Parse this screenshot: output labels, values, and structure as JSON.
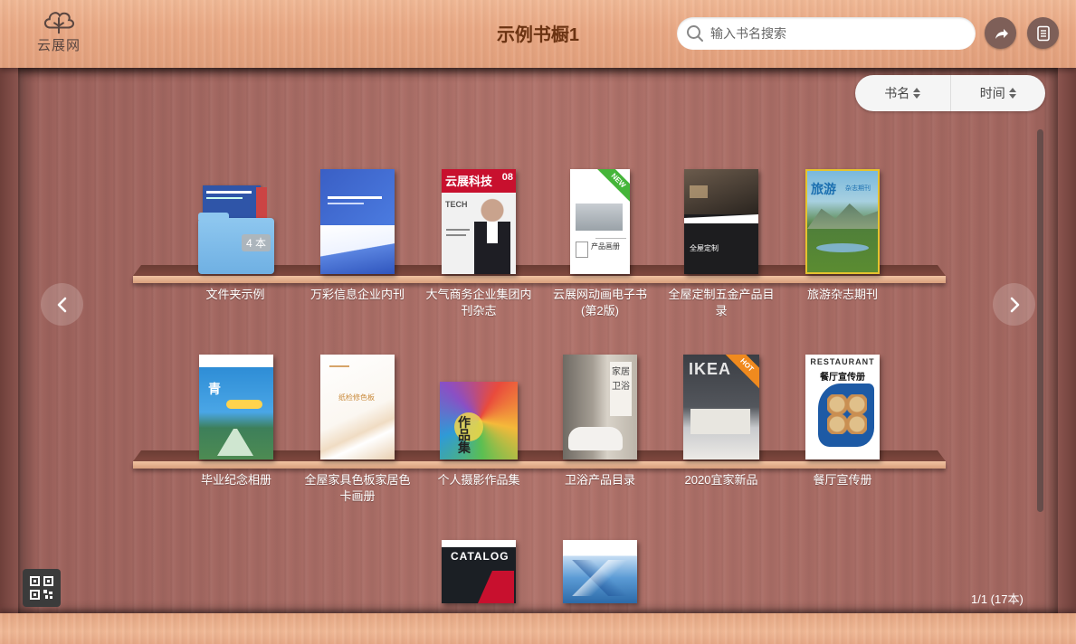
{
  "app": {
    "logo_text": "云展网",
    "title": "示例书橱1"
  },
  "search": {
    "placeholder": "输入书名搜索"
  },
  "toolbar": {
    "share_icon": "share-arrow-icon",
    "doc_icon": "document-icon"
  },
  "sort": {
    "by_name": "书名",
    "by_time": "时间"
  },
  "shelf1": [
    {
      "label": "文件夹示例",
      "folder_count": "4 本"
    },
    {
      "label": "万彩信息企业内刊"
    },
    {
      "label": "大气商务企业集团内刊杂志"
    },
    {
      "label": "云展网动画电子书(第2版)"
    },
    {
      "label": "全屋定制五金产品目录"
    },
    {
      "label": "旅游杂志期刊"
    }
  ],
  "shelf2": [
    {
      "label": "毕业纪念相册"
    },
    {
      "label": "全屋家具色板家居色卡画册"
    },
    {
      "label": "个人摄影作品集"
    },
    {
      "label": "卫浴产品目录"
    },
    {
      "label": "2020宜家新品"
    },
    {
      "label": "餐厅宣传册"
    }
  ],
  "covers": {
    "tech_title": "云展科技",
    "tech_issue": "08",
    "tech_sub": "TECH",
    "new_badge": "NEW",
    "hot_badge": "HOT",
    "travel_title": "旅游",
    "travel_tag": "杂志期刊",
    "restaurant_title": "RESTAURANT",
    "restaurant_sub": "餐厅宣传册",
    "works_title": "作品集",
    "bath_title": "家居卫浴",
    "ikea_title": "IKEA",
    "catalog_title": "CATALOG",
    "product_book": "产品画册",
    "whole_house": "全屋定制",
    "color_book": "纸检修色板"
  },
  "pagination": {
    "info": "1/1 (17本)"
  }
}
